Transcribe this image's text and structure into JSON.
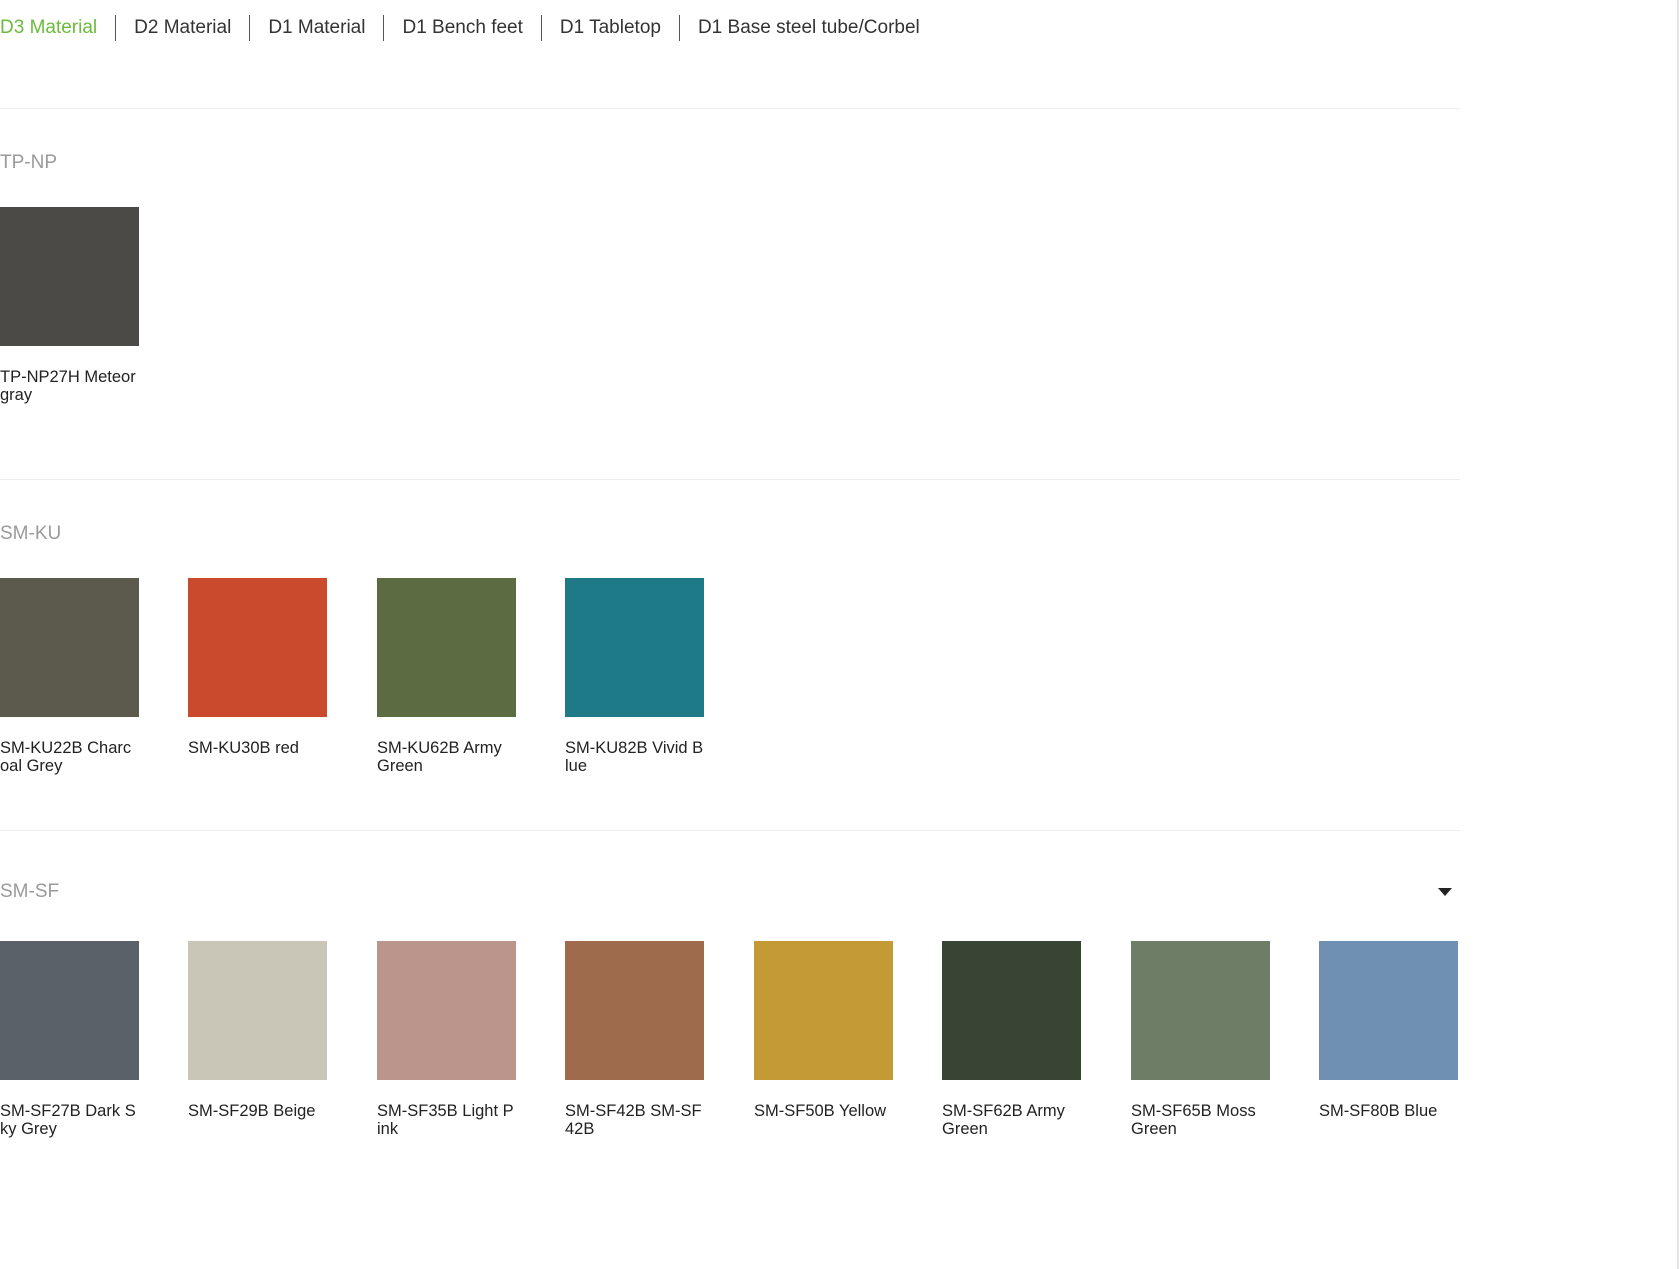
{
  "tabs": [
    {
      "label": "D3 Material",
      "active": true
    },
    {
      "label": "D2 Material",
      "active": false
    },
    {
      "label": "D1 Material",
      "active": false
    },
    {
      "label": "D1 Bench feet",
      "active": false
    },
    {
      "label": "D1 Tabletop",
      "active": false
    },
    {
      "label": "D1 Base steel tube/Corbel",
      "active": false
    }
  ],
  "groups": [
    {
      "title": "TP-NP",
      "items": [
        {
          "name": "TP-NP27H Meteor gray",
          "color": "#4b4a46"
        }
      ]
    },
    {
      "title": "SM-KU",
      "items": [
        {
          "name": "SM-KU22B Charcoal Grey",
          "color": "#5b5a4c"
        },
        {
          "name": "SM-KU30B red",
          "color": "#c94a2c"
        },
        {
          "name": "SM-KU62B Army Green",
          "color": "#5d6b43"
        },
        {
          "name": "SM-KU82B Vivid Blue",
          "color": "#1e7a87"
        }
      ]
    },
    {
      "title": "SM-SF",
      "toggle": "chevron-down-icon",
      "items": [
        {
          "name": "SM-SF27B Dark Sky Grey",
          "color": "#5a6168"
        },
        {
          "name": "SM-SF29B Beige",
          "color": "#c9c6b8"
        },
        {
          "name": "SM-SF35B Light Pink",
          "color": "#bb958c"
        },
        {
          "name": "SM-SF42B SM-SF42B",
          "color": "#9e6b4c"
        },
        {
          "name": "SM-SF50B Yellow",
          "color": "#c39a36"
        },
        {
          "name": "SM-SF62B Army Green",
          "color": "#394534"
        },
        {
          "name": "SM-SF65B Moss Green",
          "color": "#6e7d65"
        },
        {
          "name": "SM-SF80B Blue",
          "color": "#6f8fb3"
        }
      ]
    }
  ]
}
